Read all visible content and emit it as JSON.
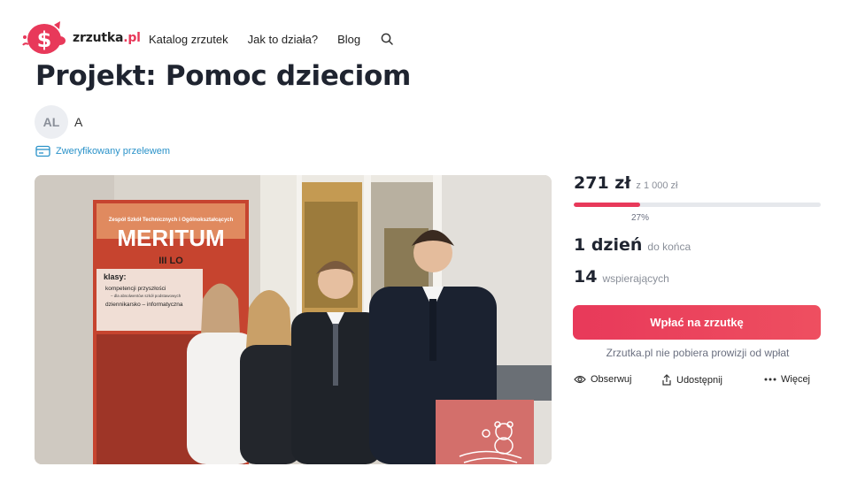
{
  "header": {
    "logo_text": "zrzutka",
    "logo_tld": ".pl",
    "nav": [
      {
        "label": "Katalog zrzutek"
      },
      {
        "label": "Jak to działa?"
      },
      {
        "label": "Blog"
      }
    ],
    "search_icon": "search-icon"
  },
  "project": {
    "title": "Projekt: Pomoc dzieciom",
    "author_initials": "AL",
    "author_name": "A",
    "verified_text": "Zweryfikowany przelewem"
  },
  "photo": {
    "banner_small": "Zespół Szkół Technicznych i Ogólnokształcących",
    "banner_big": "MERITUM",
    "banner_sub": "III LO",
    "banner_klasy": "klasy:",
    "banner_item1": "kompetencji przyszłości",
    "banner_item1b": "– dla absolwentów szkół podstawowych",
    "banner_item2": "dziennikarsko – informatyczna"
  },
  "funding": {
    "collected": "271 zł",
    "goal": "z 1 000 zł",
    "percent_label": "27%",
    "progress_fraction": 0.27,
    "days": "1 dzień",
    "days_label": "do końca",
    "supporters": "14",
    "supporters_label": "wspierających",
    "donate_label": "Wpłać na zrzutkę",
    "no_fee_text": "Zrzutka.pl nie pobiera prowizji od wpłat",
    "actions": {
      "watch": "Obserwuj",
      "share": "Udostępnij",
      "more": "Więcej"
    }
  },
  "colors": {
    "brand": "#e8395a",
    "verified": "#2a92c9",
    "text": "#1f2430"
  }
}
